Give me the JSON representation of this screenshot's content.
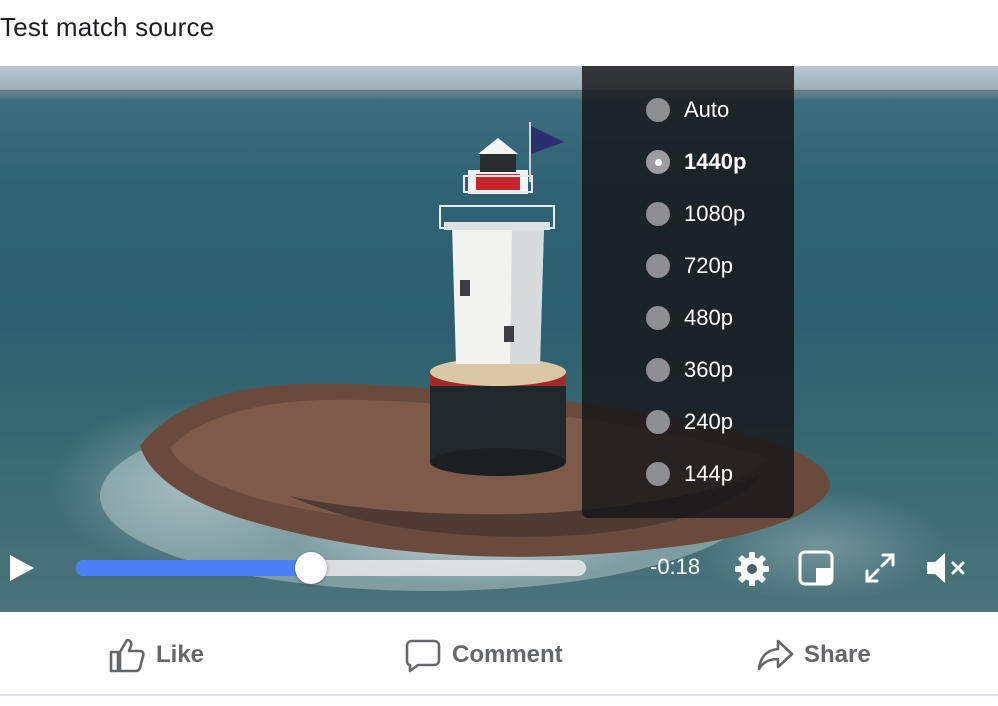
{
  "post": {
    "title": "Test match source"
  },
  "player": {
    "quality_menu": {
      "options": [
        {
          "label": "Auto",
          "selected": false
        },
        {
          "label": "1440p",
          "selected": true
        },
        {
          "label": "1080p",
          "selected": false
        },
        {
          "label": "720p",
          "selected": false
        },
        {
          "label": "480p",
          "selected": false
        },
        {
          "label": "360p",
          "selected": false
        },
        {
          "label": "240p",
          "selected": false
        },
        {
          "label": "144p",
          "selected": false
        }
      ]
    },
    "controls": {
      "progress_fraction": 0.46,
      "time_remaining": "-0:18",
      "icons": [
        "play-icon",
        "gear-icon",
        "picture-in-picture-icon",
        "fullscreen-icon",
        "muted-speaker-icon"
      ]
    },
    "accent_color": "#4b80f5"
  },
  "actions": {
    "like_label": "Like",
    "comment_label": "Comment",
    "share_label": "Share"
  }
}
